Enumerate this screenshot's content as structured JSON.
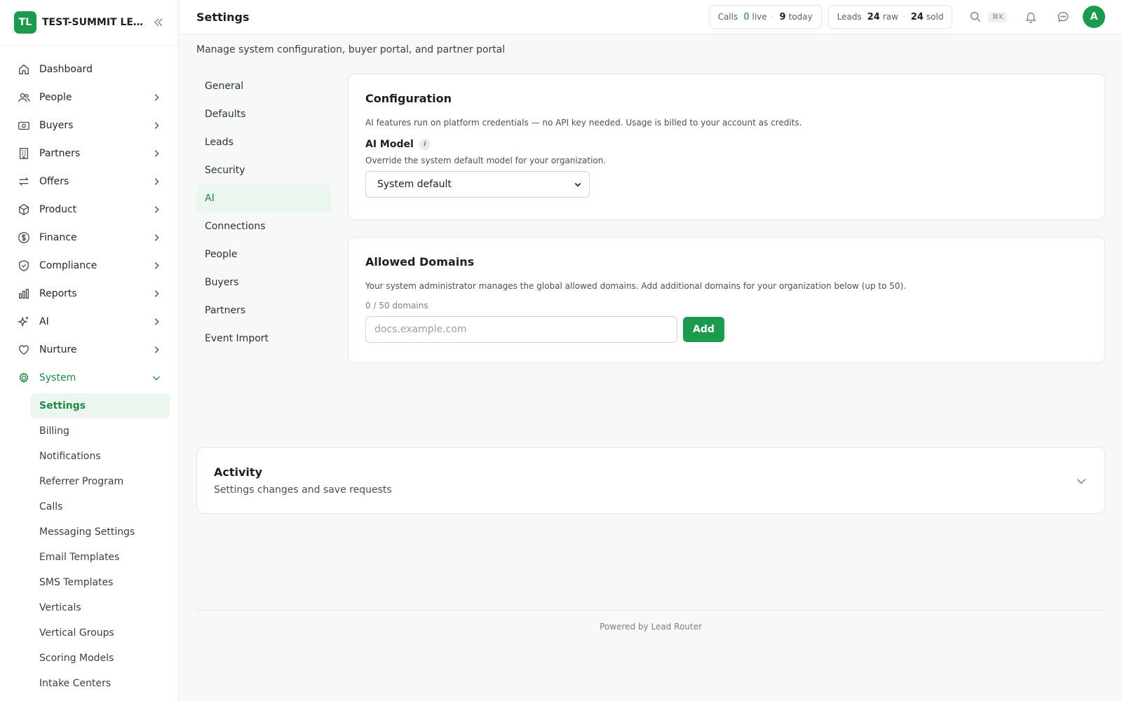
{
  "brand": {
    "initials": "TL",
    "name": "TEST-SUMMIT LEAD..."
  },
  "page": {
    "title": "Settings",
    "subtitle": "Manage system configuration, buyer portal, and partner portal"
  },
  "header": {
    "calls": {
      "label": "Calls",
      "live_count": "0",
      "live_label": "live",
      "today_count": "9",
      "today_label": "today"
    },
    "leads": {
      "label": "Leads",
      "raw_count": "24",
      "raw_label": "raw",
      "sold_count": "24",
      "sold_label": "sold"
    },
    "search_shortcut": "⌘K",
    "avatar_initial": "A"
  },
  "sidebar": {
    "items": [
      {
        "label": "Dashboard",
        "icon": "home-icon"
      },
      {
        "label": "People",
        "icon": "users-icon"
      },
      {
        "label": "Buyers",
        "icon": "cash-icon"
      },
      {
        "label": "Partners",
        "icon": "building-icon"
      },
      {
        "label": "Offers",
        "icon": "arrows-icon"
      },
      {
        "label": "Product",
        "icon": "box-icon"
      },
      {
        "label": "Finance",
        "icon": "dollar-icon"
      },
      {
        "label": "Compliance",
        "icon": "shield-icon"
      },
      {
        "label": "Reports",
        "icon": "bar-chart-icon"
      },
      {
        "label": "AI",
        "icon": "sparkles-icon"
      },
      {
        "label": "Nurture",
        "icon": "heart-icon"
      },
      {
        "label": "System",
        "icon": "gear-icon"
      }
    ],
    "system_subitems": [
      "Settings",
      "Billing",
      "Notifications",
      "Referrer Program",
      "Calls",
      "Messaging Settings",
      "Email Templates",
      "SMS Templates",
      "Verticals",
      "Vertical Groups",
      "Scoring Models",
      "Intake Centers"
    ]
  },
  "settings_nav": [
    "General",
    "Defaults",
    "Leads",
    "Security",
    "AI",
    "Connections",
    "People",
    "Buyers",
    "Partners",
    "Event Import"
  ],
  "configuration": {
    "title": "Configuration",
    "description": "AI features run on platform credentials — no API key needed. Usage is billed to your account as credits.",
    "model_label": "AI Model",
    "model_hint": "Override the system default model for your organization.",
    "model_value": "System default"
  },
  "domains": {
    "title": "Allowed Domains",
    "description": "Your system administrator manages the global allowed domains. Add additional domains for your organization below (up to 50).",
    "count": "0 / 50 domains",
    "placeholder": "docs.example.com",
    "add_label": "Add"
  },
  "activity": {
    "title": "Activity",
    "subtitle": "Settings changes and save requests"
  },
  "footer": {
    "text": "Powered by Lead Router"
  },
  "colors": {
    "accent": "#1c9a4f",
    "accent_text": "#1c8a46",
    "active_bg": "#eaf6ee"
  }
}
